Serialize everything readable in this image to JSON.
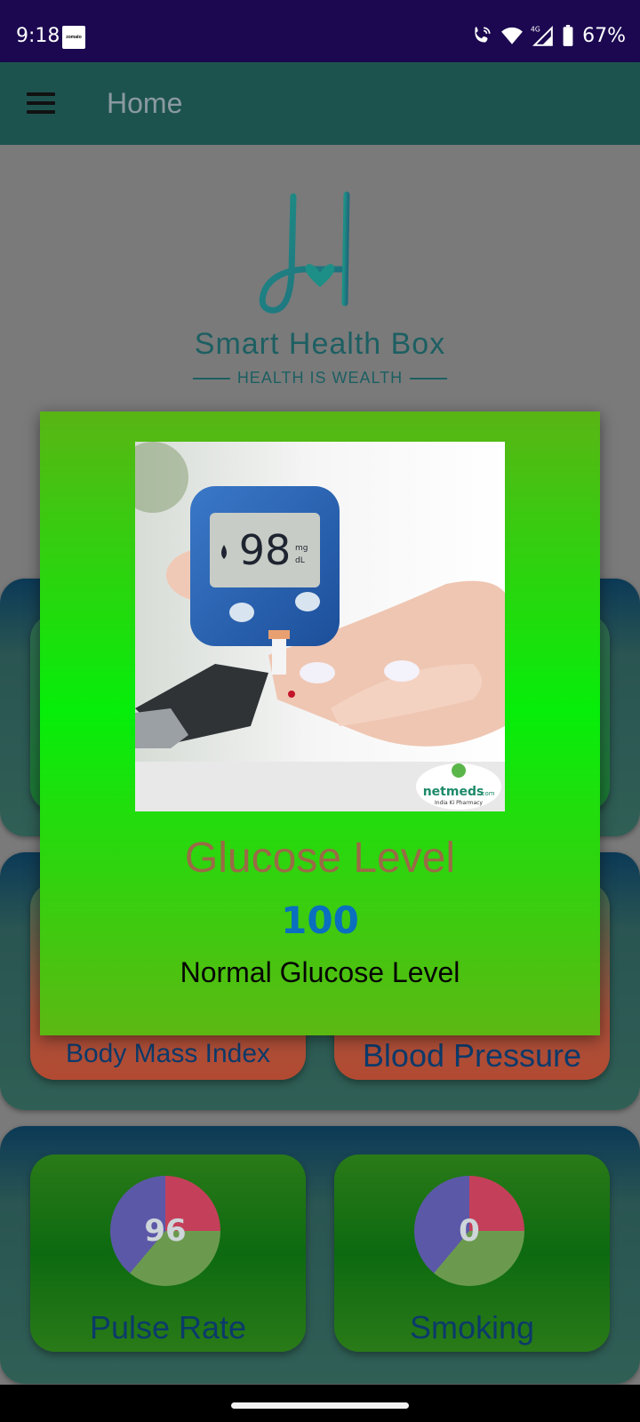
{
  "status_bar": {
    "time": "9:18",
    "app_icon_text": "zomato",
    "network": "4G",
    "battery": "67%",
    "icons": [
      "wifi-call-icon",
      "wifi-icon",
      "signal-icon",
      "battery-icon"
    ]
  },
  "app_bar": {
    "title": "Home",
    "menu_icon": "hamburger-menu-icon"
  },
  "logo": {
    "name": "Smart Health Box",
    "tagline": "HEALTH IS WEALTH"
  },
  "cards": {
    "body_mass_index": {
      "label": "Body Mass Index"
    },
    "blood_pressure": {
      "label": "Blood Pressure"
    },
    "pulse_rate": {
      "label": "Pulse Rate",
      "value": "96"
    },
    "smoking": {
      "label": "Smoking",
      "value": "0"
    }
  },
  "dialog": {
    "title": "Glucose Level",
    "value": "100",
    "status": "Normal Glucose Level",
    "image": {
      "meter_reading": "98",
      "meter_unit_top": "mg",
      "meter_unit_bottom": "dL",
      "watermark_brand": "netmeds",
      "watermark_suffix": ".com",
      "watermark_tagline": "India Ki Pharmacy"
    }
  },
  "colors": {
    "status_bar": "#1b0850",
    "app_bar": "#1d534f",
    "dialog_green": "#06ee0a",
    "dialog_title": "#9a6a46",
    "dialog_value": "#0a6fbf"
  }
}
